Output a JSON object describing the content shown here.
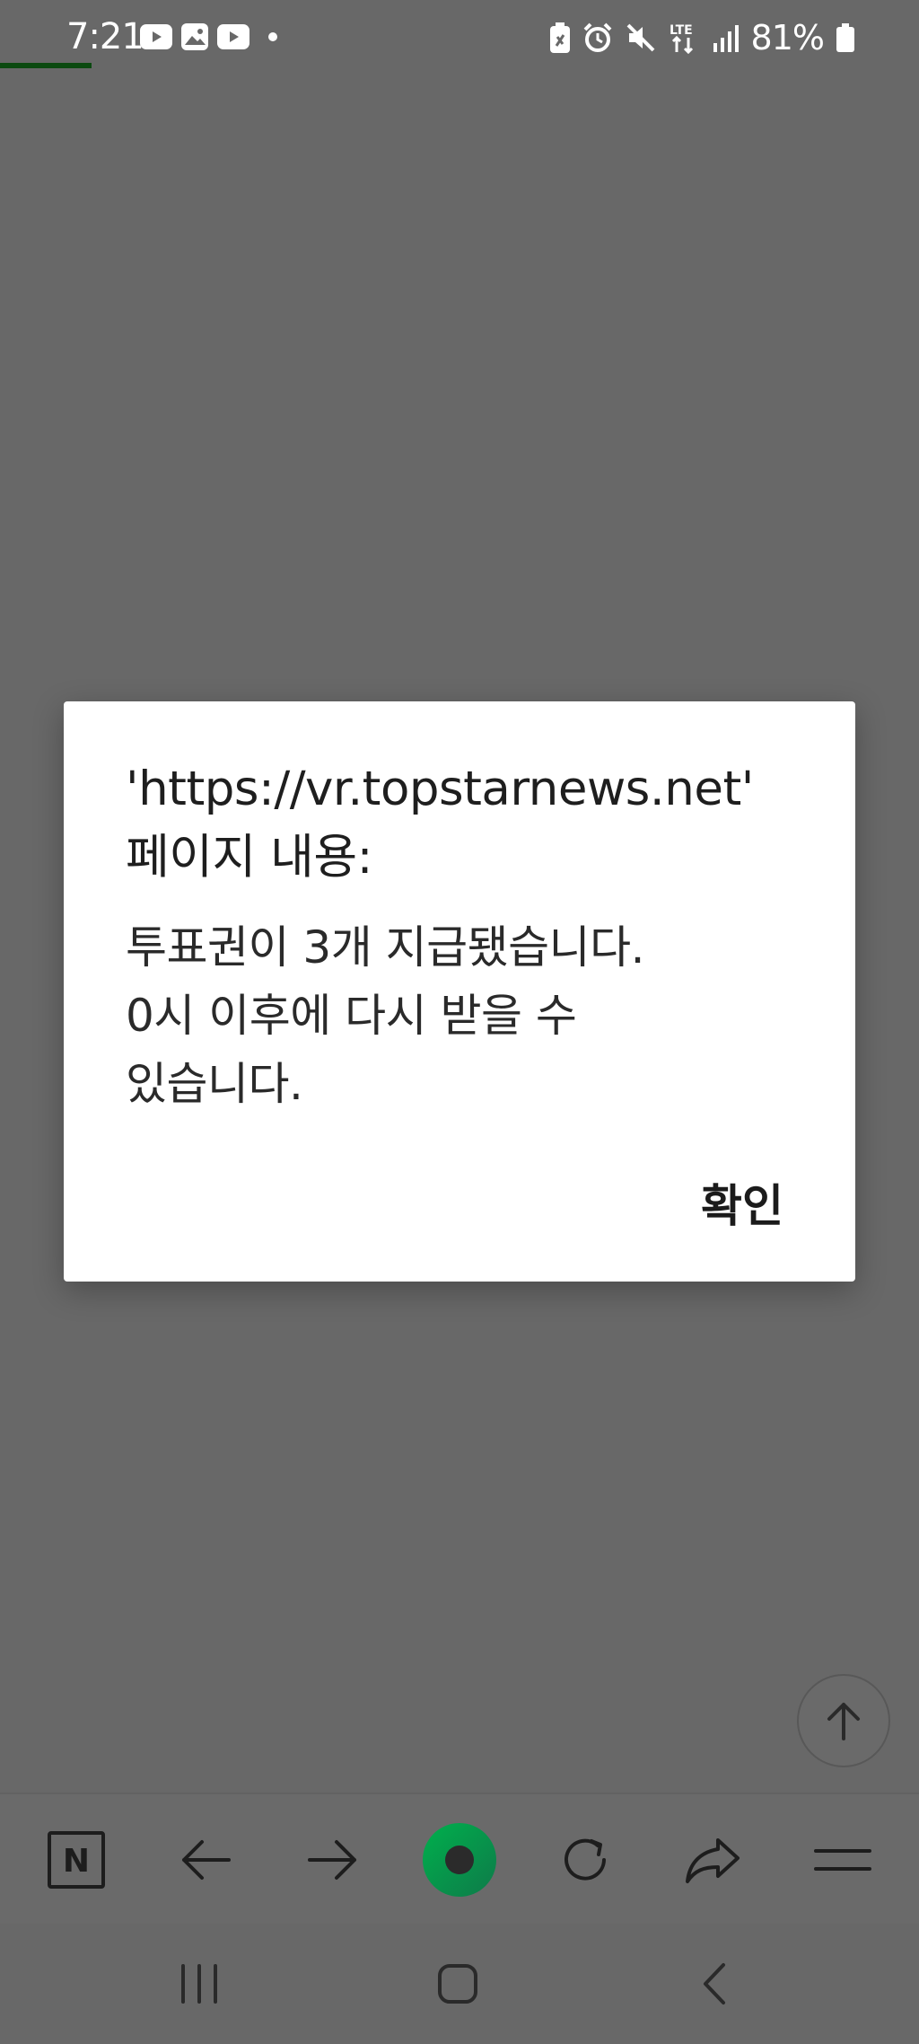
{
  "status_bar": {
    "time": "7:21",
    "battery_percent": "81%",
    "notification_icons": [
      "youtube-icon",
      "gallery-icon",
      "youtube-icon",
      "dot-icon"
    ],
    "system_icons": [
      "battery-saver-icon",
      "alarm-icon",
      "mute-icon",
      "lte-icon",
      "signal-icon",
      "battery-icon"
    ]
  },
  "page_load_progress": 0.1,
  "dialog": {
    "title_line1": "'https://vr.topstarnews.net'",
    "title_line2": "페이지 내용:",
    "message_line1": "투표권이 3개 지급됐습니다.",
    "message_line2": "0시 이후에 다시 받을 수",
    "message_line3": "있습니다.",
    "ok_label": "확인"
  },
  "toolbar": {
    "home_logo": "N",
    "icons": [
      "naver-home-icon",
      "back-arrow-icon",
      "forward-arrow-icon",
      "green-dot-icon",
      "refresh-icon",
      "share-icon",
      "menu-icon"
    ],
    "accent_color": "#03c75a"
  },
  "nav_bar": {
    "icons": [
      "recent-apps-icon",
      "home-icon",
      "back-icon"
    ]
  }
}
